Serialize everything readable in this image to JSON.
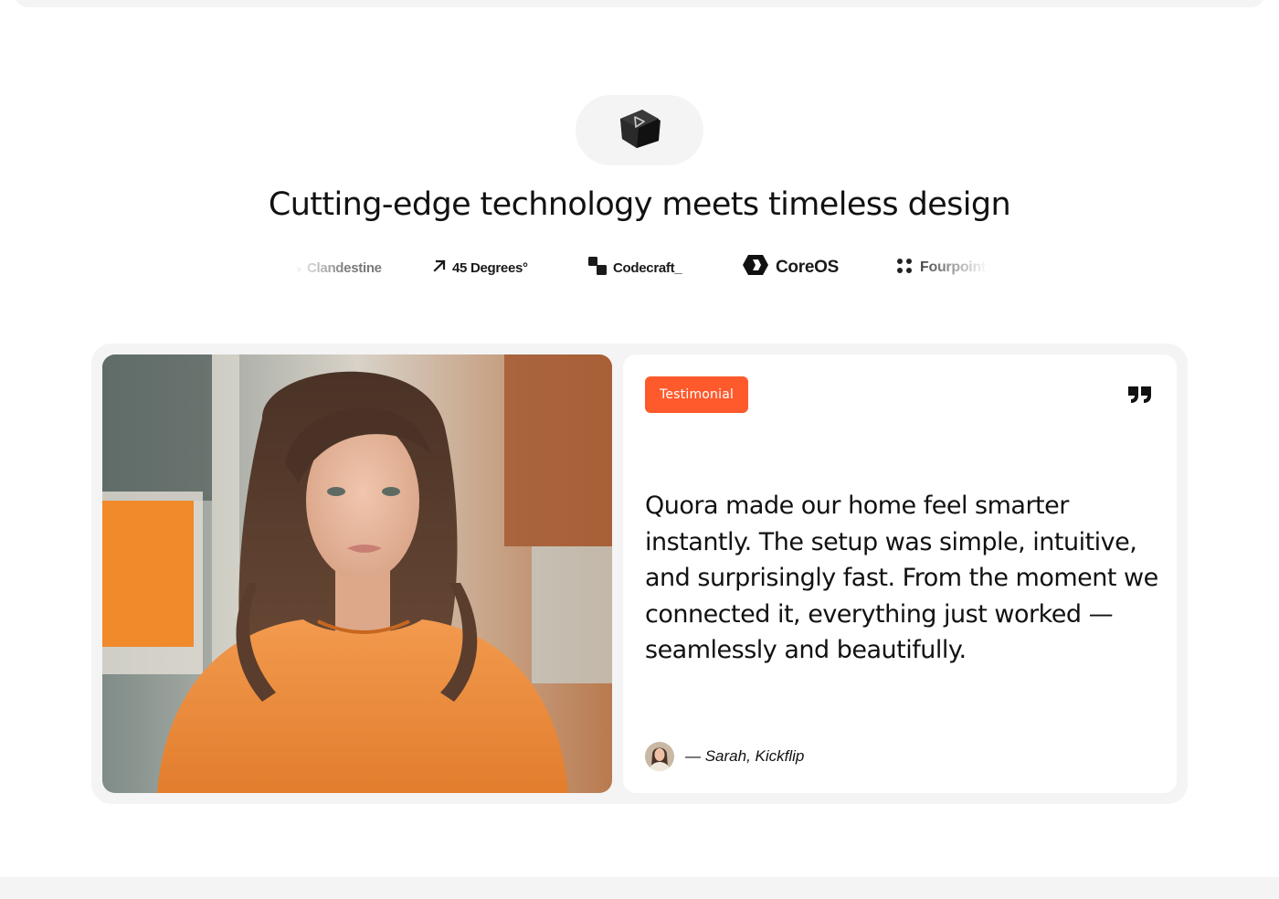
{
  "hero": {
    "icon": "play-cube-icon",
    "headline": "Cutting-edge technology meets timeless design"
  },
  "logos": [
    {
      "name": "Clandestine",
      "icon": "clandestine-dot-icon"
    },
    {
      "name": "45 Degrees°",
      "icon": "arrow-up-right-icon"
    },
    {
      "name": "Codecraft_",
      "icon": "codecraft-blocks-icon"
    },
    {
      "name": "CoreOS",
      "icon": "coreos-hexagon-icon"
    },
    {
      "name": "Fourpoint",
      "icon": "four-dots-icon"
    }
  ],
  "testimonial": {
    "badge": "Testimonial",
    "quote_icon": "quote-mark-icon",
    "quote": "Quora made our home feel smarter instantly. The setup was simple, intuitive, and surprisingly fast. From the moment we connected it, everything just worked — seamlessly and beautifully.",
    "author": "— Sarah, Kickflip",
    "photo": "woman-orange-sweater-photo"
  },
  "colors": {
    "accent": "#ff5a2c",
    "surface": "#f4f4f4",
    "text": "#111111"
  }
}
